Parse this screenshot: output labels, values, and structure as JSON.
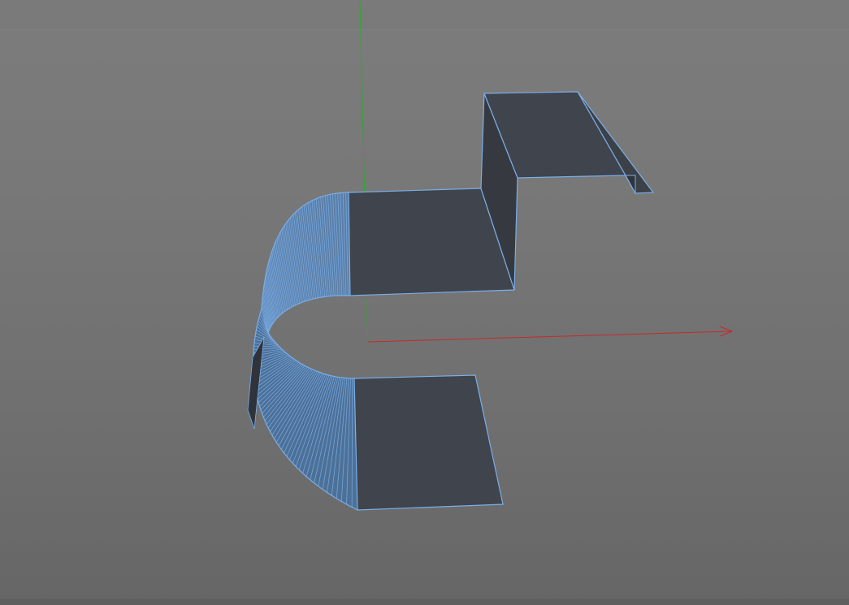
{
  "viewport": {
    "background_top": "#7c7c7c",
    "background_bottom": "#666666"
  },
  "colors": {
    "face_fill": "#40444c",
    "face_fill_dark": "#363a40",
    "edge_selected": "#7aaee8",
    "axis_x": "#c8282a",
    "axis_y": "#2fa82f"
  },
  "object": {
    "name_icon": "sheet-metal-profile",
    "selected": true,
    "bend_segments": 60
  }
}
